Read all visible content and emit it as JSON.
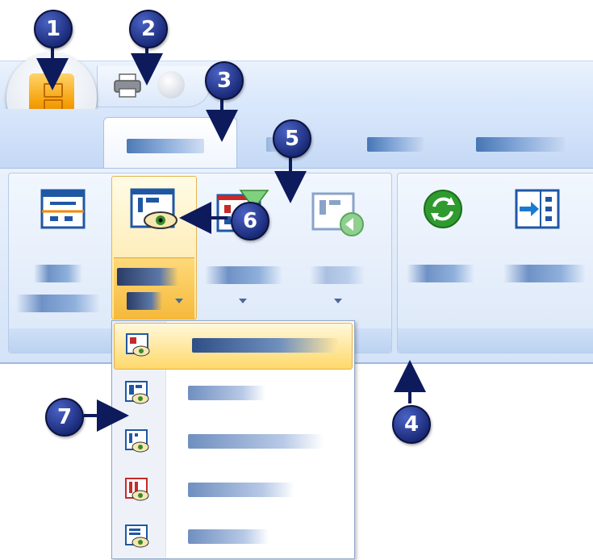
{
  "callouts": {
    "c1": "1",
    "c2": "2",
    "c3": "3",
    "c4": "4",
    "c5": "5",
    "c6": "6",
    "c7": "7"
  },
  "colors": {
    "callout": "#1b2b7a",
    "ribbon": "#d4e3f8",
    "highlight": "#ffd86a",
    "office_button": "#f5a20a"
  },
  "icons": {
    "office_button": "office-orb-icon",
    "quick_print": "printer-icon",
    "quick_extra": "circle-button-icon",
    "ribbon_buttons": [
      "layout-view-icon",
      "view-eye-icon",
      "view-filter-icon",
      "view-back-icon",
      "refresh-icon",
      "move-into-icon"
    ],
    "menu_items": [
      "view-eye-icon",
      "view-eye-icon",
      "view-eye-icon",
      "view-eye-icon",
      "view-eye-icon"
    ]
  }
}
